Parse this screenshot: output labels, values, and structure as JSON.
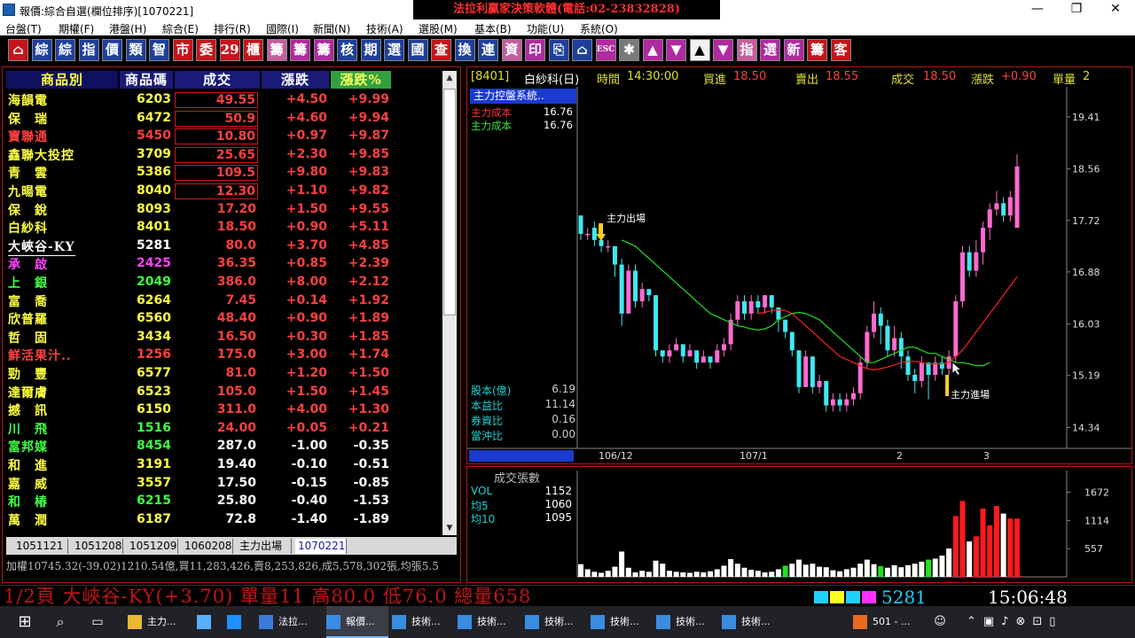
{
  "window": {
    "title": "報價:綜合自選(欄位排序)[1070221]",
    "banner": "法拉利贏家決策軟體(電話:02-23832828)",
    "controls": [
      "—",
      "❐",
      "✕"
    ]
  },
  "menu": [
    "台盤(T)",
    "期權(F)",
    "港盤(H)",
    "綜合(E)",
    "排行(R)",
    "國際(I)",
    "新聞(N)",
    "技術(A)",
    "選股(M)",
    "基本(B)",
    "功能(U)",
    "系統(O)"
  ],
  "toolbar": [
    {
      "label": "⌂",
      "style": "r"
    },
    {
      "label": "綜",
      "style": "b"
    },
    {
      "label": "綜",
      "style": "b"
    },
    {
      "label": "指",
      "style": "b"
    },
    {
      "label": "價",
      "style": "b"
    },
    {
      "label": "類",
      "style": "b"
    },
    {
      "label": "智",
      "style": "b"
    },
    {
      "label": "市",
      "style": "r"
    },
    {
      "label": "委",
      "style": "r"
    },
    {
      "label": "29",
      "style": "r"
    },
    {
      "label": "櫃",
      "style": "r"
    },
    {
      "label": "籌",
      "style": "pk"
    },
    {
      "label": "籌",
      "style": "p"
    },
    {
      "label": "籌",
      "style": "p"
    },
    {
      "label": "核",
      "style": "b"
    },
    {
      "label": "期",
      "style": "b"
    },
    {
      "label": "選",
      "style": "b"
    },
    {
      "label": "國",
      "style": "b"
    },
    {
      "label": "查",
      "style": "r"
    },
    {
      "label": "換",
      "style": "b"
    },
    {
      "label": "連",
      "style": "b"
    },
    {
      "label": "資",
      "style": "pk"
    },
    {
      "label": "印",
      "style": "p"
    },
    {
      "label": "⎘",
      "style": "b"
    },
    {
      "label": "⌂",
      "style": "b"
    },
    {
      "label": "ESC",
      "style": "p"
    },
    {
      "label": "✱",
      "style": "g"
    },
    {
      "label": "▲",
      "style": "p"
    },
    {
      "label": "▼",
      "style": "p"
    },
    {
      "label": "▲",
      "style": "w"
    },
    {
      "label": "▼",
      "style": "p"
    },
    {
      "label": "指",
      "style": "pk"
    },
    {
      "label": "選",
      "style": "p"
    },
    {
      "label": "新",
      "style": "p"
    },
    {
      "label": "籌",
      "style": "r"
    },
    {
      "label": "客",
      "style": "r"
    }
  ],
  "quote_table": {
    "headers": [
      "商品別",
      "商品碼",
      "成交",
      "漲跌",
      "漲跌%"
    ],
    "rows": [
      {
        "name": "海韻電",
        "code": "6203",
        "price": "49.55",
        "change": "+4.50",
        "pct": "+9.99",
        "color": "#ffff40",
        "boxed": true,
        "pcolor": "#ff4040"
      },
      {
        "name": "保　瑞",
        "code": "6472",
        "price": "50.9",
        "change": "+4.60",
        "pct": "+9.94",
        "color": "#ffff40",
        "boxed": true,
        "pcolor": "#ff4040"
      },
      {
        "name": "寶聯通",
        "code": "5450",
        "price": "10.80",
        "change": "+0.97",
        "pct": "+9.87",
        "color": "#ff4040",
        "boxed": true,
        "pcolor": "#ff4040"
      },
      {
        "name": "鑫聯大投控",
        "code": "3709",
        "price": "25.65",
        "change": "+2.30",
        "pct": "+9.85",
        "color": "#ffff40",
        "boxed": true,
        "pcolor": "#ff4040"
      },
      {
        "name": "青　雲",
        "code": "5386",
        "price": "109.5",
        "change": "+9.80",
        "pct": "+9.83",
        "color": "#ffff40",
        "boxed": true,
        "pcolor": "#ff4040"
      },
      {
        "name": "九暘電",
        "code": "8040",
        "price": "12.30",
        "change": "+1.10",
        "pct": "+9.82",
        "color": "#ffff40",
        "boxed": true,
        "pcolor": "#ff4040"
      },
      {
        "name": "保　銳",
        "code": "8093",
        "price": "17.20",
        "change": "+1.50",
        "pct": "+9.55",
        "color": "#ffff40",
        "boxed": false,
        "pcolor": "#ff4040"
      },
      {
        "name": "白紗科",
        "code": "8401",
        "price": "18.50",
        "change": "+0.90",
        "pct": "+5.11",
        "color": "#ffff40",
        "boxed": false,
        "pcolor": "#ff4040"
      },
      {
        "name": "大峽谷-KY",
        "code": "5281",
        "price": "80.0",
        "change": "+3.70",
        "pct": "+4.85",
        "color": "#ffffff",
        "boxed": false,
        "pcolor": "#ff4040"
      },
      {
        "name": "承　啟",
        "code": "2425",
        "price": "36.35",
        "change": "+0.85",
        "pct": "+2.39",
        "color": "#ff40ff",
        "boxed": false,
        "pcolor": "#ff4040"
      },
      {
        "name": "上　銀",
        "code": "2049",
        "price": "386.0",
        "change": "+8.00",
        "pct": "+2.12",
        "color": "#40ff40",
        "boxed": false,
        "pcolor": "#ff4040"
      },
      {
        "name": "富　喬",
        "code": "6264",
        "price": "7.45",
        "change": "+0.14",
        "pct": "+1.92",
        "color": "#ffff40",
        "boxed": false,
        "pcolor": "#ff4040"
      },
      {
        "name": "欣普羅",
        "code": "6560",
        "price": "48.40",
        "change": "+0.90",
        "pct": "+1.89",
        "color": "#ffff40",
        "boxed": false,
        "pcolor": "#ff4040"
      },
      {
        "name": "哲　固",
        "code": "3434",
        "price": "16.50",
        "change": "+0.30",
        "pct": "+1.85",
        "color": "#ffff40",
        "boxed": false,
        "pcolor": "#ff4040"
      },
      {
        "name": "鮮活果汁..",
        "code": "1256",
        "price": "175.0",
        "change": "+3.00",
        "pct": "+1.74",
        "color": "#ff4040",
        "boxed": false,
        "pcolor": "#ff4040"
      },
      {
        "name": "勁　豐",
        "code": "6577",
        "price": "81.0",
        "change": "+1.20",
        "pct": "+1.50",
        "color": "#ffff40",
        "boxed": false,
        "pcolor": "#ff4040"
      },
      {
        "name": "達爾膚",
        "code": "6523",
        "price": "105.0",
        "change": "+1.50",
        "pct": "+1.45",
        "color": "#ffff40",
        "boxed": false,
        "pcolor": "#ff4040"
      },
      {
        "name": "撼　訊",
        "code": "6150",
        "price": "311.0",
        "change": "+4.00",
        "pct": "+1.30",
        "color": "#ffff40",
        "boxed": false,
        "pcolor": "#ff4040"
      },
      {
        "name": "川　飛",
        "code": "1516",
        "price": "24.00",
        "change": "+0.05",
        "pct": "+0.21",
        "color": "#40ff40",
        "boxed": false,
        "pcolor": "#ff4040"
      },
      {
        "name": "富邦媒",
        "code": "8454",
        "price": "287.0",
        "change": "-1.00",
        "pct": "-0.35",
        "color": "#40ff40",
        "boxed": false,
        "pcolor": "#ffffff"
      },
      {
        "name": "和　進",
        "code": "3191",
        "price": "19.40",
        "change": "-0.10",
        "pct": "-0.51",
        "color": "#ffff40",
        "boxed": false,
        "pcolor": "#ffffff"
      },
      {
        "name": "嘉　威",
        "code": "3557",
        "price": "17.50",
        "change": "-0.15",
        "pct": "-0.85",
        "color": "#ffff40",
        "boxed": false,
        "pcolor": "#ffffff"
      },
      {
        "name": "和　椿",
        "code": "6215",
        "price": "25.80",
        "change": "-0.40",
        "pct": "-1.53",
        "color": "#40ff40",
        "boxed": false,
        "pcolor": "#ffffff"
      },
      {
        "name": "萬　潤",
        "code": "6187",
        "price": "72.8",
        "change": "-1.40",
        "pct": "-1.89",
        "color": "#ffff40",
        "boxed": false,
        "pcolor": "#ffffff"
      }
    ]
  },
  "tabs": [
    "1051121",
    "1051208",
    "1051209",
    "1060208",
    "主力出場",
    "1070221"
  ],
  "index_status": "加權10745.32(-39.02)1210.54億,買11,283,426,賣8,253,826,成5,578,302張,均張5.5",
  "chart_header": {
    "code": "[8401]",
    "name": "白紗科(日)",
    "time_label": "時間",
    "time": "14:30:00",
    "bid_label": "買進",
    "bid": "18.50",
    "ask_label": "賣出",
    "ask": "18.55",
    "last_label": "成交",
    "last": "18.50",
    "chg_label": "漲跌",
    "chg": "+0.90",
    "vol_label": "單量",
    "vol": "2"
  },
  "system_box": "主力控盤系統..",
  "costs": [
    {
      "label": "主力成本",
      "value": "16.76",
      "color": "#ff3030"
    },
    {
      "label": "主力成本",
      "value": "16.76",
      "color": "#40e040"
    }
  ],
  "annotations": {
    "exit": "主力出場",
    "entry": "主力進場"
  },
  "fundamentals": [
    {
      "label": "股本(億)",
      "value": "6.19"
    },
    {
      "label": "本益比",
      "value": "11.14"
    },
    {
      "label": "券資比",
      "value": "0.16"
    },
    {
      "label": "當沖比",
      "value": "0.00"
    }
  ],
  "volume_header": "成交張數",
  "volume_labels": [
    {
      "label": "VOL",
      "value": "1152",
      "color": "#20d0d0"
    },
    {
      "label": "均5",
      "value": "1060",
      "color": "#20d0d0"
    },
    {
      "label": "均10",
      "value": "1095",
      "color": "#20d0d0"
    }
  ],
  "chart_data": {
    "type": "candlestick",
    "y_ticks": [
      19.41,
      18.56,
      17.72,
      16.88,
      16.03,
      15.19,
      14.34
    ],
    "ylim": [
      14.0,
      19.9
    ],
    "x_ticks": [
      "106/12",
      "107/1",
      "2",
      "3"
    ],
    "ohlc": [
      [
        17.8,
        17.5,
        17.8,
        17.4
      ],
      [
        17.5,
        17.5,
        17.6,
        17.4
      ],
      [
        17.6,
        17.4,
        17.7,
        17.3
      ],
      [
        17.4,
        17.3,
        17.5,
        17.2
      ],
      [
        17.3,
        17.3,
        17.4,
        17.2
      ],
      [
        17.3,
        17.0,
        17.3,
        16.8
      ],
      [
        17.0,
        16.2,
        17.1,
        16.0
      ],
      [
        16.2,
        16.9,
        17.0,
        16.2
      ],
      [
        16.9,
        16.4,
        17.0,
        16.3
      ],
      [
        16.4,
        16.6,
        16.7,
        16.3
      ],
      [
        16.6,
        16.5,
        16.6,
        16.4
      ],
      [
        16.5,
        15.6,
        16.5,
        15.5
      ],
      [
        15.6,
        15.5,
        15.6,
        15.4
      ],
      [
        15.5,
        15.6,
        15.7,
        15.4
      ],
      [
        15.6,
        15.7,
        15.8,
        15.6
      ],
      [
        15.7,
        15.5,
        15.7,
        15.4
      ],
      [
        15.5,
        15.6,
        15.7,
        15.5
      ],
      [
        15.6,
        15.4,
        15.6,
        15.3
      ],
      [
        15.4,
        15.5,
        15.6,
        15.4
      ],
      [
        15.5,
        15.4,
        15.5,
        15.3
      ],
      [
        15.4,
        15.6,
        15.7,
        15.4
      ],
      [
        15.6,
        15.7,
        15.8,
        15.5
      ],
      [
        15.7,
        16.1,
        16.2,
        15.6
      ],
      [
        16.1,
        16.4,
        16.5,
        16.0
      ],
      [
        16.4,
        16.2,
        16.5,
        16.1
      ],
      [
        16.2,
        16.4,
        16.5,
        16.1
      ],
      [
        16.4,
        16.3,
        16.5,
        16.2
      ],
      [
        16.3,
        16.5,
        16.5,
        16.2
      ],
      [
        16.5,
        16.3,
        16.5,
        16.2
      ],
      [
        16.3,
        16.1,
        16.3,
        15.9
      ],
      [
        16.1,
        15.9,
        16.1,
        15.8
      ],
      [
        15.9,
        15.6,
        15.9,
        15.5
      ],
      [
        15.6,
        15.0,
        15.6,
        14.9
      ],
      [
        15.0,
        15.5,
        15.6,
        15.0
      ],
      [
        15.5,
        15.0,
        15.5,
        14.9
      ],
      [
        15.0,
        15.1,
        15.2,
        14.9
      ],
      [
        15.1,
        14.7,
        15.1,
        14.6
      ],
      [
        14.7,
        14.8,
        14.9,
        14.6
      ],
      [
        14.8,
        14.7,
        14.9,
        14.6
      ],
      [
        14.7,
        14.8,
        14.9,
        14.6
      ],
      [
        14.8,
        14.9,
        15.0,
        14.7
      ],
      [
        14.9,
        15.4,
        15.5,
        14.8
      ],
      [
        15.4,
        15.9,
        16.0,
        15.3
      ],
      [
        15.9,
        16.2,
        16.4,
        15.8
      ],
      [
        16.2,
        16.0,
        16.3,
        15.7
      ],
      [
        16.0,
        15.6,
        16.1,
        15.5
      ],
      [
        15.6,
        15.8,
        16.0,
        15.5
      ],
      [
        15.8,
        15.5,
        15.9,
        15.3
      ],
      [
        15.5,
        15.2,
        15.6,
        15.1
      ],
      [
        15.2,
        15.1,
        15.3,
        14.9
      ],
      [
        15.1,
        15.4,
        15.5,
        15.0
      ],
      [
        15.4,
        15.2,
        15.4,
        14.8
      ],
      [
        15.2,
        15.4,
        15.5,
        15.1
      ],
      [
        15.4,
        15.3,
        15.5,
        15.2
      ],
      [
        15.3,
        15.5,
        15.6,
        15.2
      ],
      [
        15.5,
        16.4,
        16.5,
        15.4
      ],
      [
        16.4,
        17.2,
        17.3,
        16.3
      ],
      [
        17.2,
        16.9,
        17.3,
        16.8
      ],
      [
        16.9,
        17.2,
        17.4,
        16.8
      ],
      [
        17.2,
        17.6,
        17.7,
        17.0
      ],
      [
        17.6,
        17.9,
        18.0,
        17.4
      ],
      [
        17.9,
        18.0,
        18.2,
        17.8
      ],
      [
        18.0,
        17.8,
        18.1,
        17.7
      ],
      [
        17.8,
        18.1,
        18.2,
        17.7
      ],
      [
        17.6,
        18.6,
        18.8,
        17.6
      ]
    ],
    "ma_green": [
      17.4,
      17.35,
      17.3,
      17.2,
      17.1,
      17.0,
      16.9,
      16.8,
      16.7,
      16.6,
      16.5,
      16.4,
      16.3,
      16.2,
      16.15,
      16.1,
      16.05,
      16.0,
      15.98,
      15.95,
      15.93,
      15.95,
      16.0,
      16.1,
      16.15,
      16.2,
      16.22,
      16.2,
      16.15,
      16.1,
      16.0,
      15.9,
      15.8,
      15.7,
      15.6,
      15.5,
      15.4,
      15.4,
      15.45,
      15.5,
      15.55,
      15.6,
      15.65,
      15.65,
      15.6,
      15.55,
      15.55,
      15.5,
      15.45,
      15.4,
      15.4,
      15.38,
      15.35,
      15.35,
      15.4
    ],
    "ma_red_start_index": 26,
    "ma_red": [
      16.2,
      16.22,
      16.25,
      16.26,
      16.25,
      16.2,
      16.1,
      16.0,
      15.9,
      15.8,
      15.7,
      15.6,
      15.5,
      15.45,
      15.4,
      15.35,
      15.3,
      15.28,
      15.3,
      15.33,
      15.36,
      15.4,
      15.42,
      15.42,
      15.4,
      15.38,
      15.38,
      15.38,
      15.4,
      15.5,
      15.6,
      15.75,
      15.9,
      16.05,
      16.2,
      16.35,
      16.5,
      16.65,
      16.8
    ],
    "volume": [
      250,
      150,
      100,
      80,
      120,
      200,
      500,
      180,
      90,
      120,
      100,
      320,
      260,
      120,
      100,
      90,
      80,
      100,
      90,
      110,
      150,
      220,
      350,
      260,
      180,
      140,
      120,
      90,
      100,
      150,
      220,
      260,
      340,
      240,
      260,
      200,
      190,
      130,
      110,
      150,
      180,
      260,
      340,
      250,
      210,
      180,
      230,
      190,
      230,
      260,
      300,
      340,
      360,
      420,
      560,
      1200,
      1500,
      700,
      800,
      1350,
      1020,
      1400,
      1250,
      1150,
      1152
    ],
    "volume_up": [
      false,
      false,
      true,
      false,
      true,
      false,
      false,
      true,
      false,
      true,
      false,
      false,
      false,
      true,
      true,
      false,
      true,
      false,
      true,
      false,
      true,
      true,
      true,
      true,
      false,
      true,
      false,
      true,
      false,
      false,
      false,
      false,
      false,
      true,
      false,
      true,
      false,
      true,
      false,
      true,
      true,
      true,
      true,
      true,
      false,
      false,
      true,
      false,
      false,
      false,
      true,
      false,
      true,
      false,
      true,
      true,
      true,
      false,
      true,
      true,
      true,
      true,
      false,
      true,
      true
    ],
    "volume_ticks": [
      1672,
      1114,
      557
    ],
    "volume_ylim": [
      0,
      2100
    ]
  },
  "ticker": {
    "text": "1/2頁 大峽谷-KY(+3.70) 單量11 高80.0 低76.0 總量658",
    "code": "5281",
    "time": "15:06:48"
  },
  "taskbar": [
    {
      "label": "主力...",
      "icon": "folder-icon"
    },
    {
      "label": "",
      "icon": "monitor-icon"
    },
    {
      "label": "",
      "icon": "browser-icon"
    },
    {
      "label": "法拉...",
      "icon": "app-icon"
    },
    {
      "label": "報價...",
      "icon": "chart-icon",
      "active": true
    },
    {
      "label": "技術...",
      "icon": "chart-icon"
    },
    {
      "label": "技術...",
      "icon": "chart-icon"
    },
    {
      "label": "技術...",
      "icon": "chart-icon"
    },
    {
      "label": "技術...",
      "icon": "chart-icon"
    },
    {
      "label": "技術...",
      "icon": "chart-icon"
    },
    {
      "label": "技術...",
      "icon": "chart-icon"
    },
    {
      "label": "501 - ...",
      "icon": "mail-icon"
    }
  ]
}
